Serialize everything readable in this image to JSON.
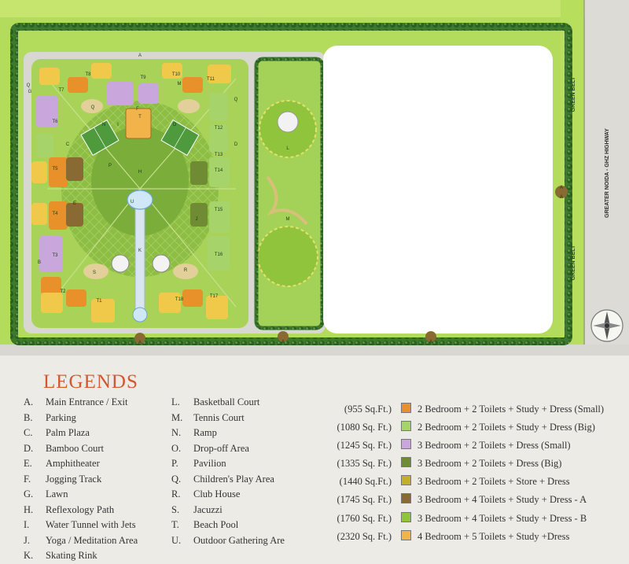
{
  "map": {
    "road_labels": {
      "green_belt_top": "GREEN BELT",
      "green_belt_bottom": "GREEN BELT",
      "highway": "GREATER NOIDA - GHZ HIGHWAY"
    },
    "tower_labels": [
      "T7",
      "T8",
      "T9",
      "T10",
      "T11",
      "T12",
      "T13",
      "T14",
      "T15",
      "T16",
      "T17",
      "T18",
      "T1",
      "T2",
      "T3",
      "T4",
      "T5",
      "T6"
    ],
    "area_letters": [
      "A",
      "A",
      "A",
      "A",
      "A",
      "A",
      "B",
      "C",
      "D",
      "E",
      "F",
      "G",
      "H",
      "I",
      "J",
      "K",
      "L",
      "M",
      "M",
      "N",
      "O",
      "P",
      "Q",
      "Q",
      "Q",
      "R",
      "S",
      "T",
      "U"
    ],
    "colors": {
      "grass": "#9cc84a",
      "outer_green": "#b4dc5c",
      "road": "#d8d7d2",
      "hedge": "#2e6a2a"
    }
  },
  "legend": {
    "title": "LEGENDS",
    "col1": [
      {
        "key": "A.",
        "label": "Main Entrance / Exit"
      },
      {
        "key": "B.",
        "label": "Parking"
      },
      {
        "key": "C.",
        "label": "Palm Plaza"
      },
      {
        "key": "D.",
        "label": "Bamboo Court"
      },
      {
        "key": "E.",
        "label": "Amphitheater"
      },
      {
        "key": "F.",
        "label": "Jogging Track"
      },
      {
        "key": "G.",
        "label": "Lawn"
      },
      {
        "key": "H.",
        "label": "Reflexology Path"
      },
      {
        "key": "I.",
        "label": "Water Tunnel with Jets"
      },
      {
        "key": "J.",
        "label": "Yoga / Meditation Area"
      },
      {
        "key": "K.",
        "label": "Skating Rink"
      }
    ],
    "col2": [
      {
        "key": "L.",
        "label": "Basketball Court"
      },
      {
        "key": "M.",
        "label": "Tennis Court"
      },
      {
        "key": "N.",
        "label": "Ramp"
      },
      {
        "key": "O.",
        "label": "Drop-off Area"
      },
      {
        "key": "P.",
        "label": "Pavilion"
      },
      {
        "key": "Q.",
        "label": "Children's Play Area"
      },
      {
        "key": "R.",
        "label": "Club House"
      },
      {
        "key": "S.",
        "label": "Jacuzzi"
      },
      {
        "key": "T.",
        "label": "Beach Pool"
      },
      {
        "key": "U.",
        "label": "Outdoor Gathering Are"
      }
    ],
    "units": [
      {
        "area": "(955 Sq.Ft.)",
        "color": "#e8902a",
        "label": "2 Bedroom + 2 Toilets + Study + Dress (Small)"
      },
      {
        "area": "(1080 Sq. Ft.)",
        "color": "#a6d46a",
        "label": "2 Bedroom + 2 Toilets + Study + Dress (Big)"
      },
      {
        "area": "(1245 Sq. Ft.)",
        "color": "#c9a6dc",
        "label": "3 Bedroom + 2 Toilets + Dress (Small)"
      },
      {
        "area": "(1335 Sq. Ft.)",
        "color": "#6f8b33",
        "label": "3 Bedroom + 2 Toilets + Dress (Big)"
      },
      {
        "area": "(1440 Sq.Ft.)",
        "color": "#c3b02a",
        "label": "3 Bedroom + 2 Toilets + Store + Dress"
      },
      {
        "area": "(1745 Sq. Ft.)",
        "color": "#8a6a33",
        "label": "3 Bedroom + 4 Toilets + Study + Dress - A"
      },
      {
        "area": "(1760 Sq. Ft.)",
        "color": "#8fc43c",
        "label": "3 Bedroom + 4 Toilets + Study + Dress - B"
      },
      {
        "area": "(2320 Sq. Ft.)",
        "color": "#f2b44a",
        "label": "4 Bedroom + 5 Toilets + Study +Dress"
      }
    ]
  }
}
